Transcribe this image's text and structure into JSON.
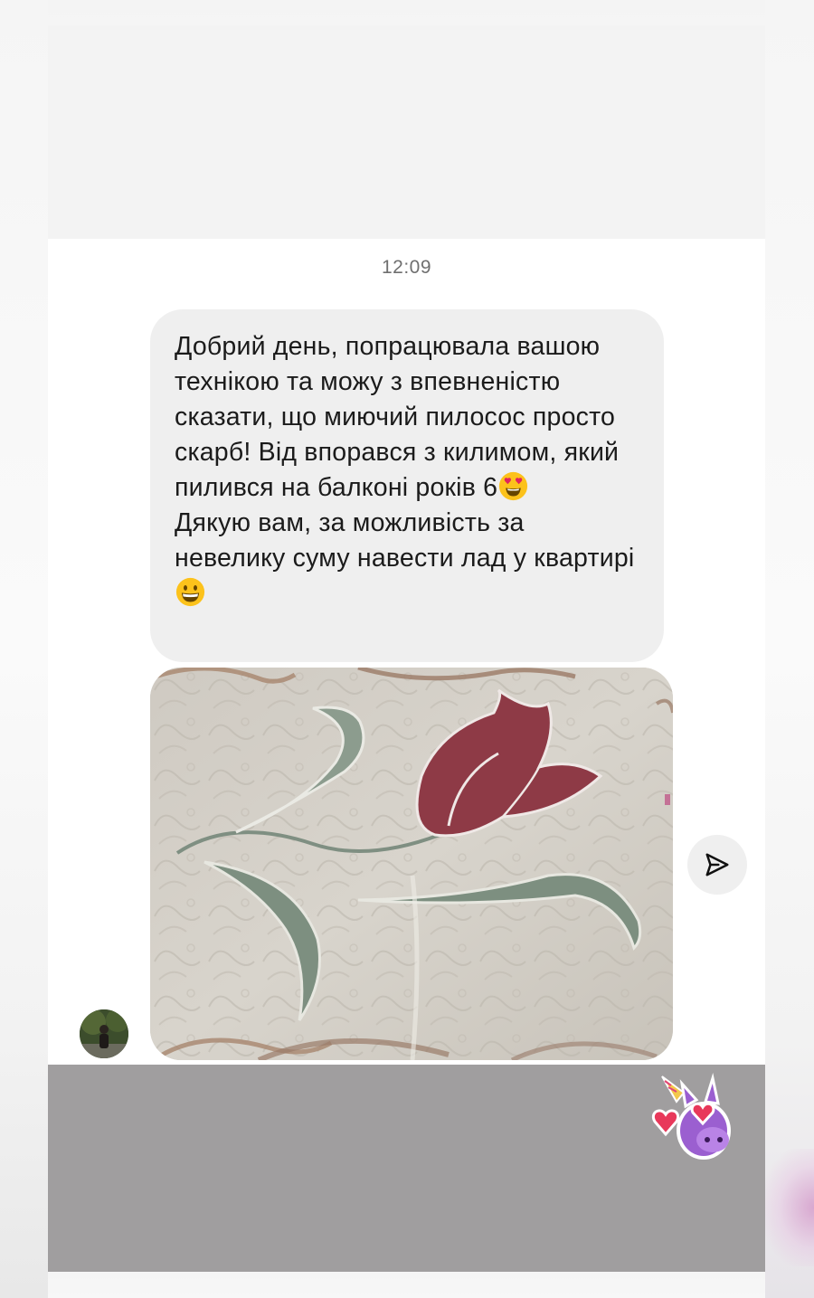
{
  "chat": {
    "timestamp": "12:09",
    "message": {
      "line1": "Добрий день, попрацювала вашою технікою та можу з впевненістю сказати, що миючий пилосос просто скарб! Від впорався з килимом, який пилився на балконі років 6",
      "line1_emoji": "heart-eyes-emoji",
      "line2": "Дякую вам, за можливість за невелику суму навести лад у квартирі",
      "line2_emoji": "grinning-face-emoji"
    },
    "photo": {
      "subject": "carpet-photo",
      "icon": "tulip-carpet-image"
    },
    "share_icon": "paper-plane-icon",
    "avatar_icon": "user-avatar",
    "sticker_icon": "unicorn-hearts-sticker"
  },
  "colors": {
    "bubble": "#efefef",
    "timestamp": "#6f6f6f",
    "text": "#1b1b1b",
    "overlay": "#a09e9f",
    "top_box": "#f3f3f3"
  }
}
